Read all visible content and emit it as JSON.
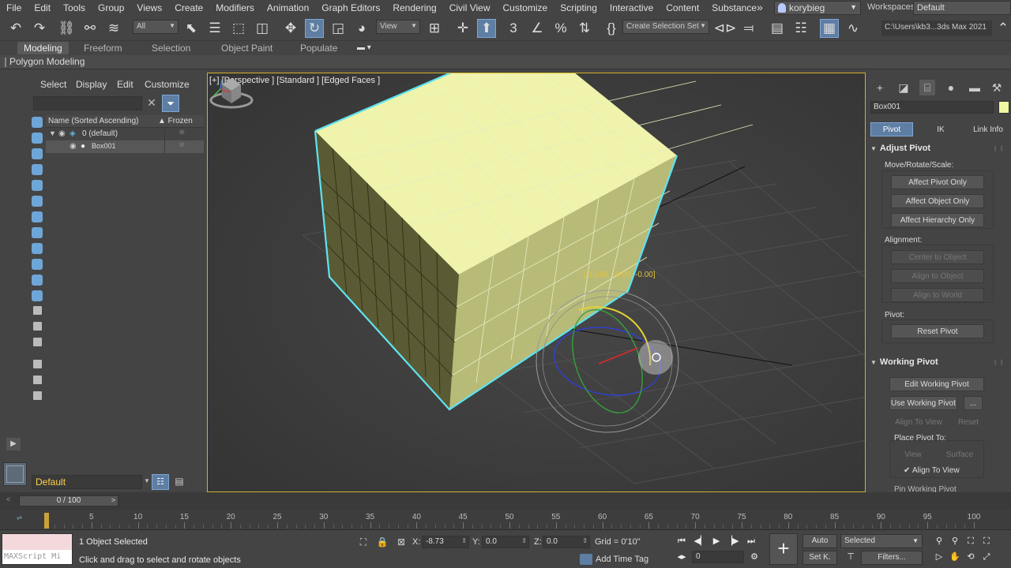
{
  "menu": [
    "File",
    "Edit",
    "Tools",
    "Group",
    "Views",
    "Create",
    "Modifiers",
    "Animation",
    "Graph Editors",
    "Rendering",
    "Civil View",
    "Customize",
    "Scripting",
    "Interactive",
    "Content",
    "Substance"
  ],
  "user": "korybieg",
  "workspaces": {
    "label": "Workspaces:",
    "value": "Default"
  },
  "toolbar": {
    "selection_filter": "All",
    "ref_coord": "View",
    "named_selection": "Create Selection Set",
    "project_path": "C:\\Users\\kb3...3ds Max 2021"
  },
  "ribbon": {
    "tabs": [
      "Modeling",
      "Freeform",
      "Selection",
      "Object Paint",
      "Populate"
    ],
    "active_tab": "Modeling",
    "panel_label": "Polygon Modeling"
  },
  "explorer": {
    "menu": [
      "Select",
      "Display",
      "Edit",
      "Customize"
    ],
    "search_value": "",
    "col_name": "Name (Sorted Ascending)",
    "col_frozen": "▲ Frozen",
    "rows": [
      {
        "name": "0 (default)"
      },
      {
        "name": "Box001"
      }
    ],
    "layer": "Default"
  },
  "viewport": {
    "label": "[+] [Perspective ] [Standard ] [Edged Faces ]",
    "gizmo_readout": "[-10.96, -0.00, -0.00]"
  },
  "command_panel": {
    "object_name": "Box001",
    "object_color": "#f1f7a1",
    "hierarchy_tabs": [
      "Pivot",
      "IK",
      "Link Info"
    ],
    "adjust_pivot": {
      "title": "Adjust Pivot",
      "move_rotate_scale": "Move/Rotate/Scale:",
      "buttons": [
        "Affect Pivot Only",
        "Affect Object Only",
        "Affect Hierarchy Only"
      ],
      "alignment": "Alignment:",
      "align_buttons": [
        "Center to Object",
        "Align to Object",
        "Align to World"
      ],
      "pivot": "Pivot:",
      "reset": "Reset Pivot"
    },
    "working_pivot": {
      "title": "Working Pivot",
      "edit": "Edit Working Pivot",
      "use": "Use Working Pivot",
      "more": "...",
      "align_to_view": "Align To View",
      "reset": "Reset",
      "place_pivot_to": "Place Pivot To:",
      "view": "View",
      "surface": "Surface",
      "align_check": "Align To View",
      "align_checked": true,
      "pin": "Pin Working Pivot"
    }
  },
  "timeline": {
    "frame_display": "0 / 100",
    "ticks": [
      "5",
      "10",
      "15",
      "20",
      "25",
      "30",
      "35",
      "40",
      "45",
      "50",
      "55",
      "60",
      "65",
      "70",
      "75",
      "80",
      "85",
      "90",
      "95",
      "100"
    ]
  },
  "status": {
    "maxscript": "MAXScript Mi",
    "selected": "1 Object Selected",
    "prompt": "Click and drag to select and rotate objects",
    "x_label": "X:",
    "x_value": "-8.73",
    "y_label": "Y:",
    "y_value": "0.0",
    "z_label": "Z:",
    "z_value": "0.0",
    "grid": "Grid = 0'10\"",
    "add_time_tag": "Add Time Tag",
    "current_frame": "0",
    "auto": "Auto",
    "set_k": "Set K.",
    "key_mode": "Selected",
    "filters": "Filters..."
  },
  "colors": {
    "accent": "#5e7ea3",
    "viewport_border": "#d4b12a",
    "box_top": "#eff3ab",
    "selection_outline": "#5ee3f0"
  }
}
